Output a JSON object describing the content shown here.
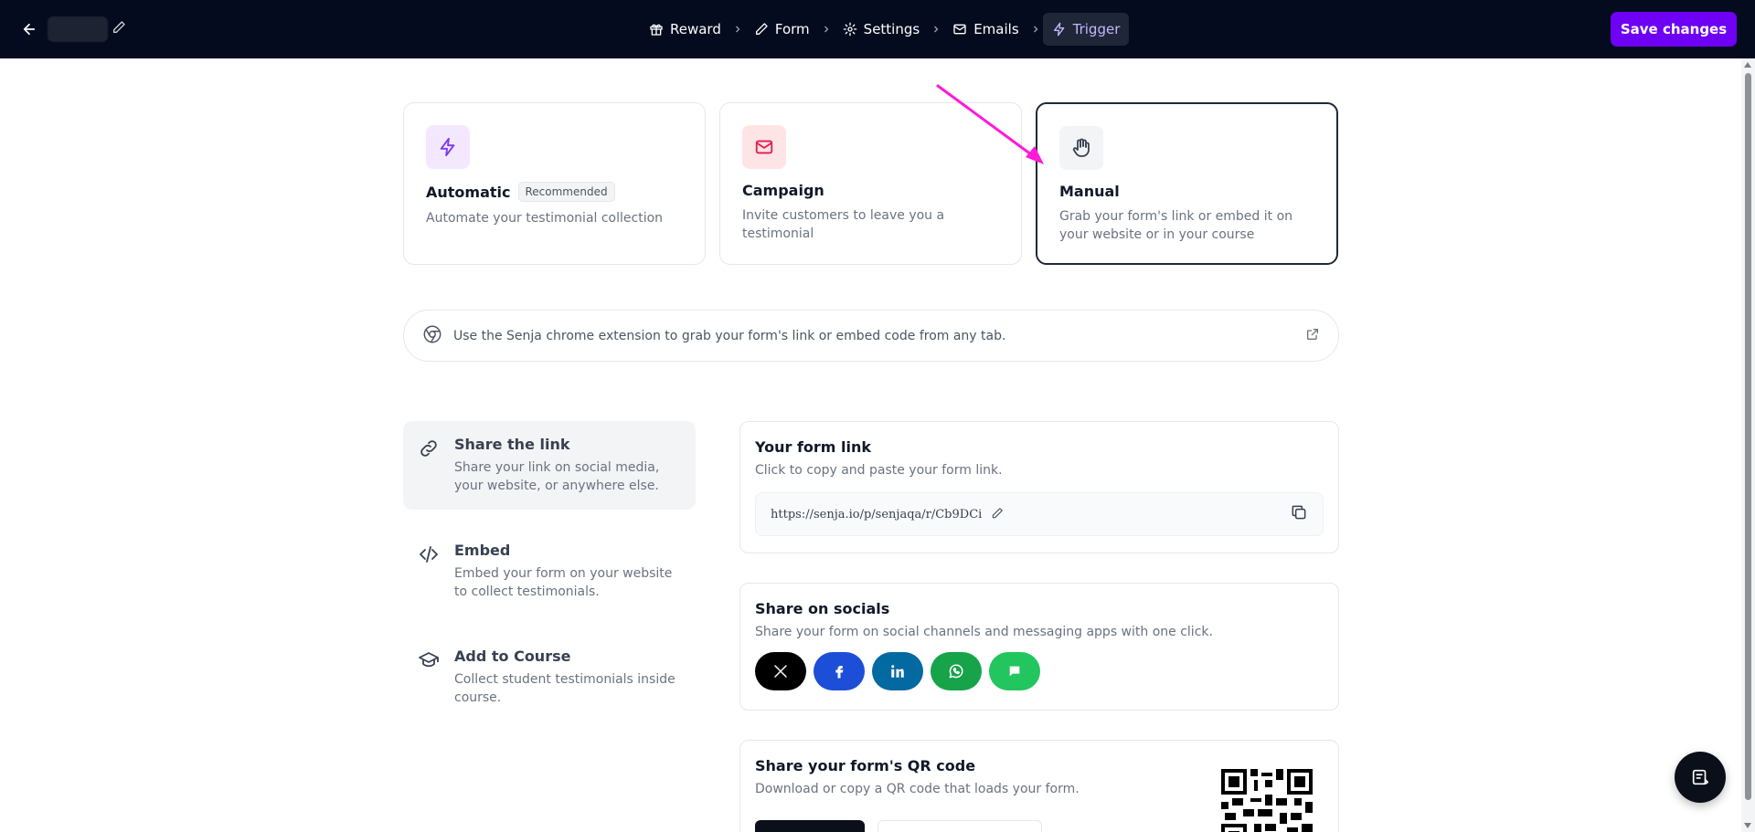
{
  "header": {
    "steps": [
      {
        "label": "Reward",
        "icon": "gift-icon"
      },
      {
        "label": "Form",
        "icon": "pencil-icon"
      },
      {
        "label": "Settings",
        "icon": "gear-icon"
      },
      {
        "label": "Emails",
        "icon": "mail-icon"
      },
      {
        "label": "Trigger",
        "icon": "bolt-icon",
        "active": true
      }
    ],
    "save_label": "Save changes"
  },
  "triggers": [
    {
      "title": "Automatic",
      "badge": "Recommended",
      "desc": "Automate your testimonial collection",
      "icon": "bolt-icon",
      "color": "#7c3aed",
      "bg": "#f3e8ff"
    },
    {
      "title": "Campaign",
      "desc": "Invite customers to leave you a testimonial",
      "icon": "mail-icon",
      "color": "#e11d48",
      "bg": "#ffe4e6"
    },
    {
      "title": "Manual",
      "desc": "Grab your form's link or embed it on your website or in your course",
      "icon": "hand-icon",
      "color": "#374151",
      "bg": "#f3f4f6",
      "selected": true
    }
  ],
  "banner": {
    "text": "Use the Senja chrome extension to grab your form's link or embed code from any tab."
  },
  "nav": [
    {
      "title": "Share the link",
      "desc": "Share your link on social media, your website, or anywhere else.",
      "icon": "link-icon",
      "active": true
    },
    {
      "title": "Embed",
      "desc": "Embed your form on your website to collect testimonials.",
      "icon": "code-icon"
    },
    {
      "title": "Add to Course",
      "desc": "Collect student testimonials inside course.",
      "icon": "graduation-cap-icon"
    }
  ],
  "form_link": {
    "title": "Your form link",
    "desc": "Click to copy and paste your form link.",
    "url": "https://senja.io/p/senjaqa/r/Cb9DCi"
  },
  "socials": {
    "title": "Share on socials",
    "desc": "Share your form on social channels and messaging apps with one click.",
    "channels": [
      {
        "name": "x",
        "color": "#000000"
      },
      {
        "name": "facebook",
        "color": "#1d4ed8"
      },
      {
        "name": "linkedin",
        "color": "#0369a1"
      },
      {
        "name": "whatsapp",
        "color": "#16a34a"
      },
      {
        "name": "message",
        "color": "#22c55e"
      }
    ]
  },
  "qr": {
    "title": "Share your form's QR code",
    "desc": "Download or copy a QR code that loads your form."
  },
  "colors": {
    "accent": "#6d00f5",
    "topbar": "#050b1e",
    "annotation": "#ff1ad9"
  }
}
